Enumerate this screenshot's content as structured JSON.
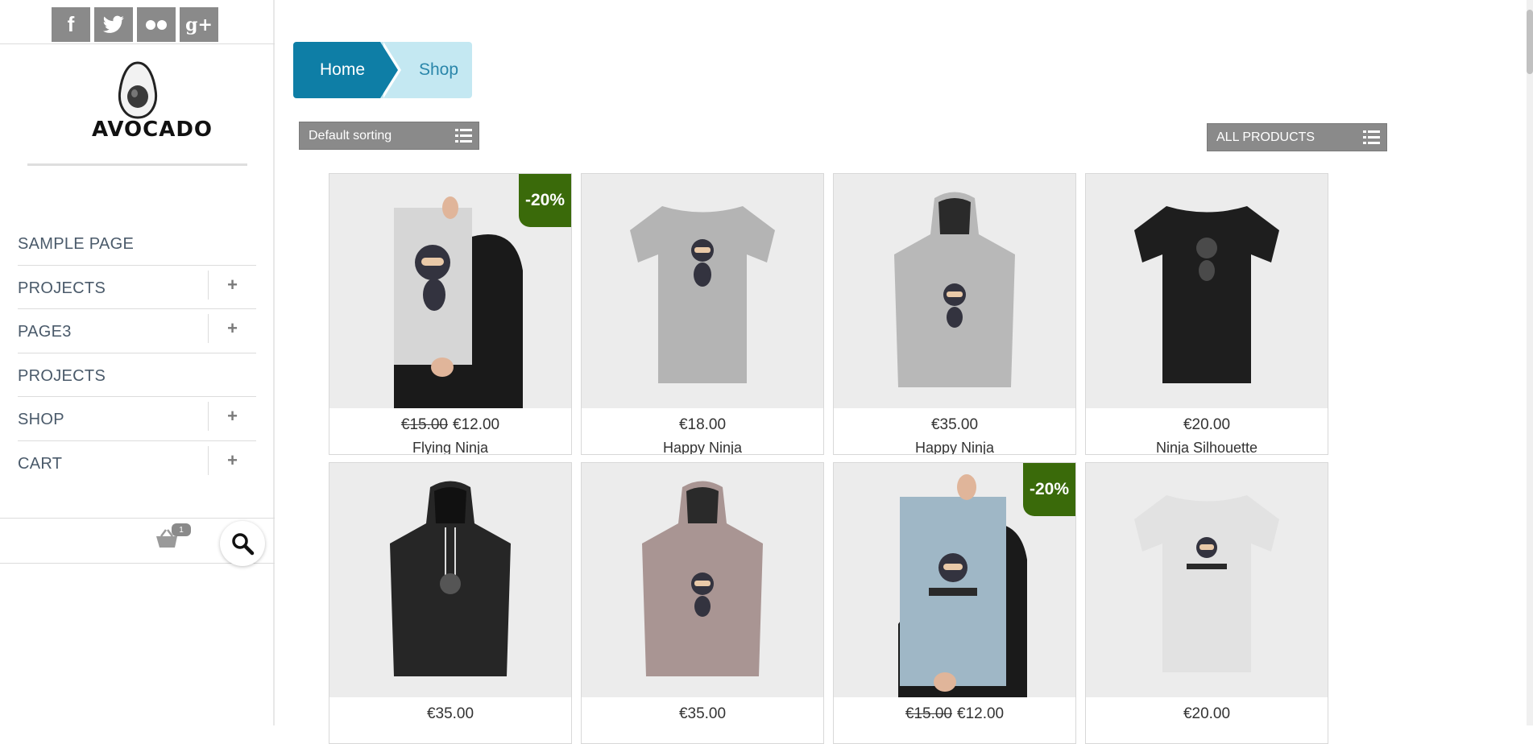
{
  "social": {
    "facebook": "f",
    "twitter": "twitter-icon",
    "flickr": "flickr-icon",
    "googleplus": "g+"
  },
  "logo": {
    "text": "AVOCADO"
  },
  "nav": {
    "items": [
      {
        "label": "SAMPLE PAGE",
        "has_submenu": false
      },
      {
        "label": "PROJECTS",
        "has_submenu": true
      },
      {
        "label": "PAGE3",
        "has_submenu": true
      },
      {
        "label": "PROJECTS",
        "has_submenu": false
      },
      {
        "label": "SHOP",
        "has_submenu": true
      },
      {
        "label": "CART",
        "has_submenu": true
      }
    ],
    "expand_symbol": "+"
  },
  "cart": {
    "count": "1"
  },
  "breadcrumb": {
    "home": "Home",
    "current": "Shop"
  },
  "sorting": {
    "label": "Default sorting"
  },
  "filter": {
    "label": "ALL PRODUCTS"
  },
  "colors": {
    "accent": "#0e7ea6",
    "breadcrumb_current_bg": "#c4e8f2",
    "sale_badge": "#3a6a0a",
    "button_gray": "#8a8a8a"
  },
  "products": [
    {
      "name": "Flying Ninja",
      "old_price": "€15.00",
      "price": "€12.00",
      "badge": "-20%"
    },
    {
      "name": "Happy Ninja",
      "old_price": "",
      "price": "€18.00",
      "badge": ""
    },
    {
      "name": "Happy Ninja",
      "old_price": "",
      "price": "€35.00",
      "badge": ""
    },
    {
      "name": "Ninja Silhouette",
      "old_price": "",
      "price": "€20.00",
      "badge": ""
    },
    {
      "name": "",
      "old_price": "",
      "price": "€35.00",
      "badge": ""
    },
    {
      "name": "",
      "old_price": "",
      "price": "€35.00",
      "badge": ""
    },
    {
      "name": "",
      "old_price": "€15.00",
      "price": "€12.00",
      "badge": "-20%"
    },
    {
      "name": "",
      "old_price": "",
      "price": "€20.00",
      "badge": ""
    }
  ]
}
